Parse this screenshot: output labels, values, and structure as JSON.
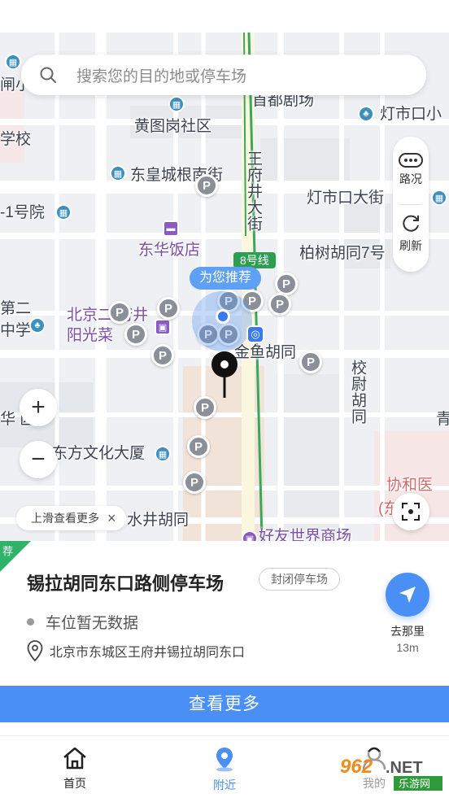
{
  "search": {
    "placeholder": "搜索您的目的地或停车场"
  },
  "side_panel": {
    "traffic_label": "路况",
    "refresh_label": "刷新"
  },
  "map": {
    "labels": {
      "school_left": "闸小",
      "school_left2": "学校",
      "huangtugang": "黄图岗社区",
      "donghuangcheng": "东皇城根南街",
      "no1": "-1号院",
      "donghua_hotel": "东华饭店",
      "wangfujing_st": "王府井大街",
      "dengshikou_da": "灯市口大街",
      "dengshikou_xiao": "灯市口小",
      "shoudu_theatre": "首都剧场",
      "baishu7": "柏树胡同7号",
      "line8": "8号线",
      "recommend": "为您推荐",
      "di2": "第二",
      "zhongxue": "中学",
      "beijing_wfj": "北京二 府井",
      "yangguang": "阳光菜",
      "jinyu": "金鱼胡同",
      "xiaowei": "校尉胡同",
      "hua_community": "华 区",
      "dongfang": "东方文化大厦",
      "shuijing": "水井胡同",
      "xiehe": "协和医",
      "xiehe2": "(东 院",
      "haoyou": "好友世界商场",
      "qing": "青"
    },
    "poi_icons": [
      "building-icon",
      "hotel-icon",
      "metro-icon"
    ],
    "hint": "上滑查看更多",
    "hint_close": "×"
  },
  "card": {
    "tag": "荐",
    "title": "锡拉胡同东口路侧停车场",
    "badge": "封闭停车场",
    "status": "车位暂无数据",
    "address": "北京市东城区王府井锡拉胡同东口",
    "go_label": "去那里",
    "distance": "13m"
  },
  "more_button": "查看更多",
  "tabs": [
    {
      "label": "首页",
      "icon": "home-icon",
      "active": false
    },
    {
      "label": "附近",
      "icon": "location-icon",
      "active": true
    },
    {
      "label": "我的",
      "icon": "user-icon",
      "active": false
    }
  ],
  "watermark": {
    "text": "962.NET",
    "subtext": "乐游网"
  },
  "colors": {
    "accent": "#4a8ff5",
    "tag_green": "#2fb26a",
    "metro_line": "#2e9e52",
    "parking_pin": "#8a8f98"
  }
}
